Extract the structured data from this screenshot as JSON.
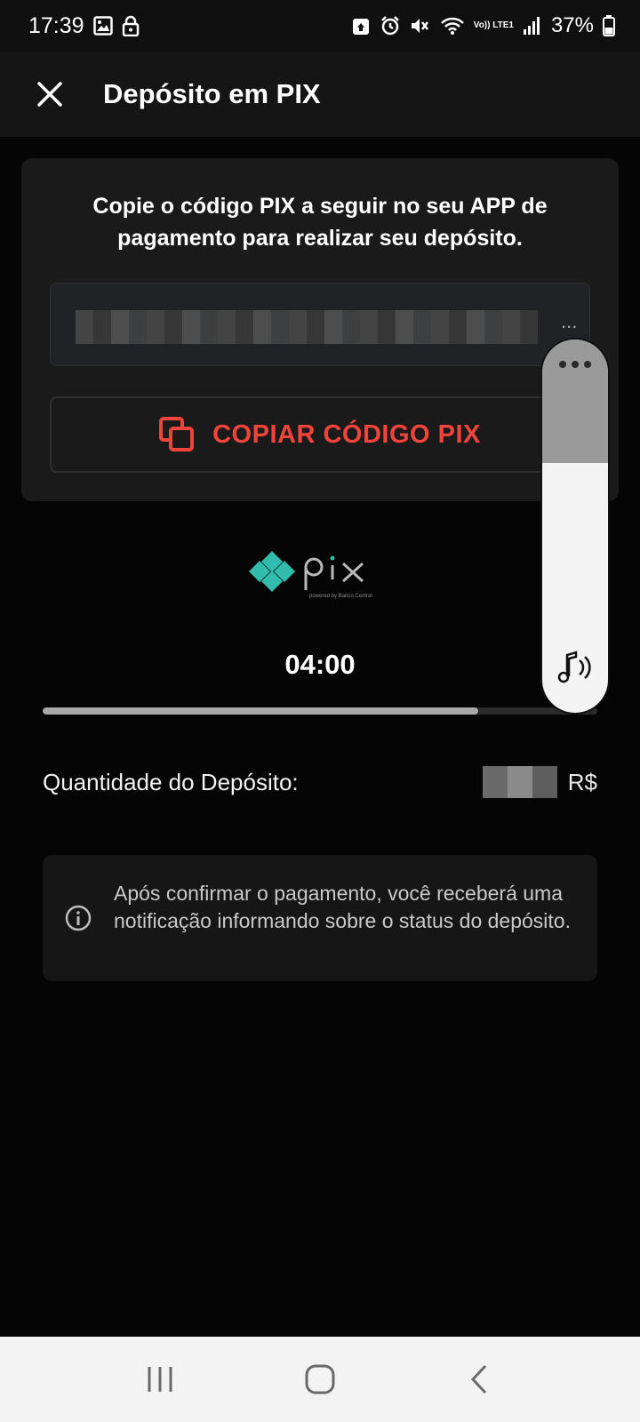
{
  "status_bar": {
    "time": "17:39",
    "volte": "Vo)) LTE1",
    "battery_percent": "37%",
    "icons_left": [
      "gallery-icon",
      "lock-icon"
    ],
    "icons_right": [
      "recycle-icon",
      "alarm-icon",
      "mute-icon",
      "wifi-icon",
      "volte-icon",
      "signal-icon",
      "battery-icon"
    ]
  },
  "app_bar": {
    "title": "Depósito em PIX",
    "close_icon": "close-icon"
  },
  "pix_card": {
    "instructions": "Copie o código PIX a seguir no seu APP de pagamento para realizar seu depósito.",
    "code_ellipsis": "...",
    "copy_button_label": "COPIAR CÓDIGO PIX",
    "copy_icon": "copy-icon",
    "accent_color": "#f0443a"
  },
  "pix_logo": {
    "wordmark": "pix",
    "tagline": "powered by Banco Central",
    "color": "#32bcad"
  },
  "timer": {
    "countdown": "04:00",
    "progress_fraction": 0.785
  },
  "deposit": {
    "label": "Quantidade do Depósito:",
    "currency": "R$"
  },
  "info": {
    "icon": "info-icon",
    "message": "Após confirmar o pagamento, você receberá uma notificação informando sobre o status do depósito."
  },
  "volume_overlay": {
    "level_fraction": 0.67,
    "more_icon": "more-dots-icon",
    "stream_icon": "music-note-icon"
  },
  "nav_bar": {
    "buttons": [
      "recents-icon",
      "home-icon",
      "back-icon"
    ]
  }
}
